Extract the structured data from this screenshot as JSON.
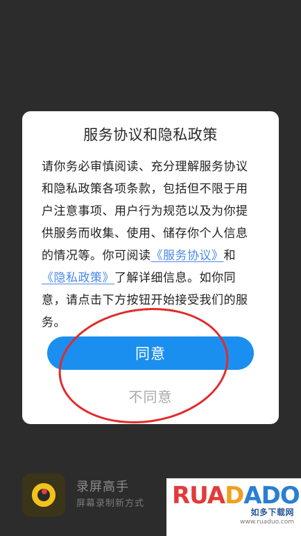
{
  "dialog": {
    "title": "服务协议和隐私政策",
    "body_part1": "请你务必审慎阅读、充分理解服务协议和隐私政策各项条款，包括但不限于用户注意事项、用户行为规范以及为你提供服务而收集、使用、储存你个人信息的情况等。你可阅读",
    "link_service": "《服务协议》",
    "body_and": "和",
    "link_privacy": "《隐私政策》",
    "body_part2": "了解详细信息。如你同意，请点击下方按钮开始接受我们的服务。",
    "agree_label": "同意",
    "disagree_label": "不同意"
  },
  "app": {
    "name": "录屏高手",
    "subtitle": "屏幕录制新方式",
    "icon": "camera-lens-icon"
  },
  "watermark": {
    "logo_r": "RUA",
    "logo_d": "D",
    "logo_o": "ADO",
    "cn": "如多下载网",
    "url": "www.ruaduo.com"
  },
  "colors": {
    "primary_button": "#1b8ff0",
    "link": "#4a88e8",
    "annotation": "#e22a2a",
    "background": "#2c2c2c"
  }
}
